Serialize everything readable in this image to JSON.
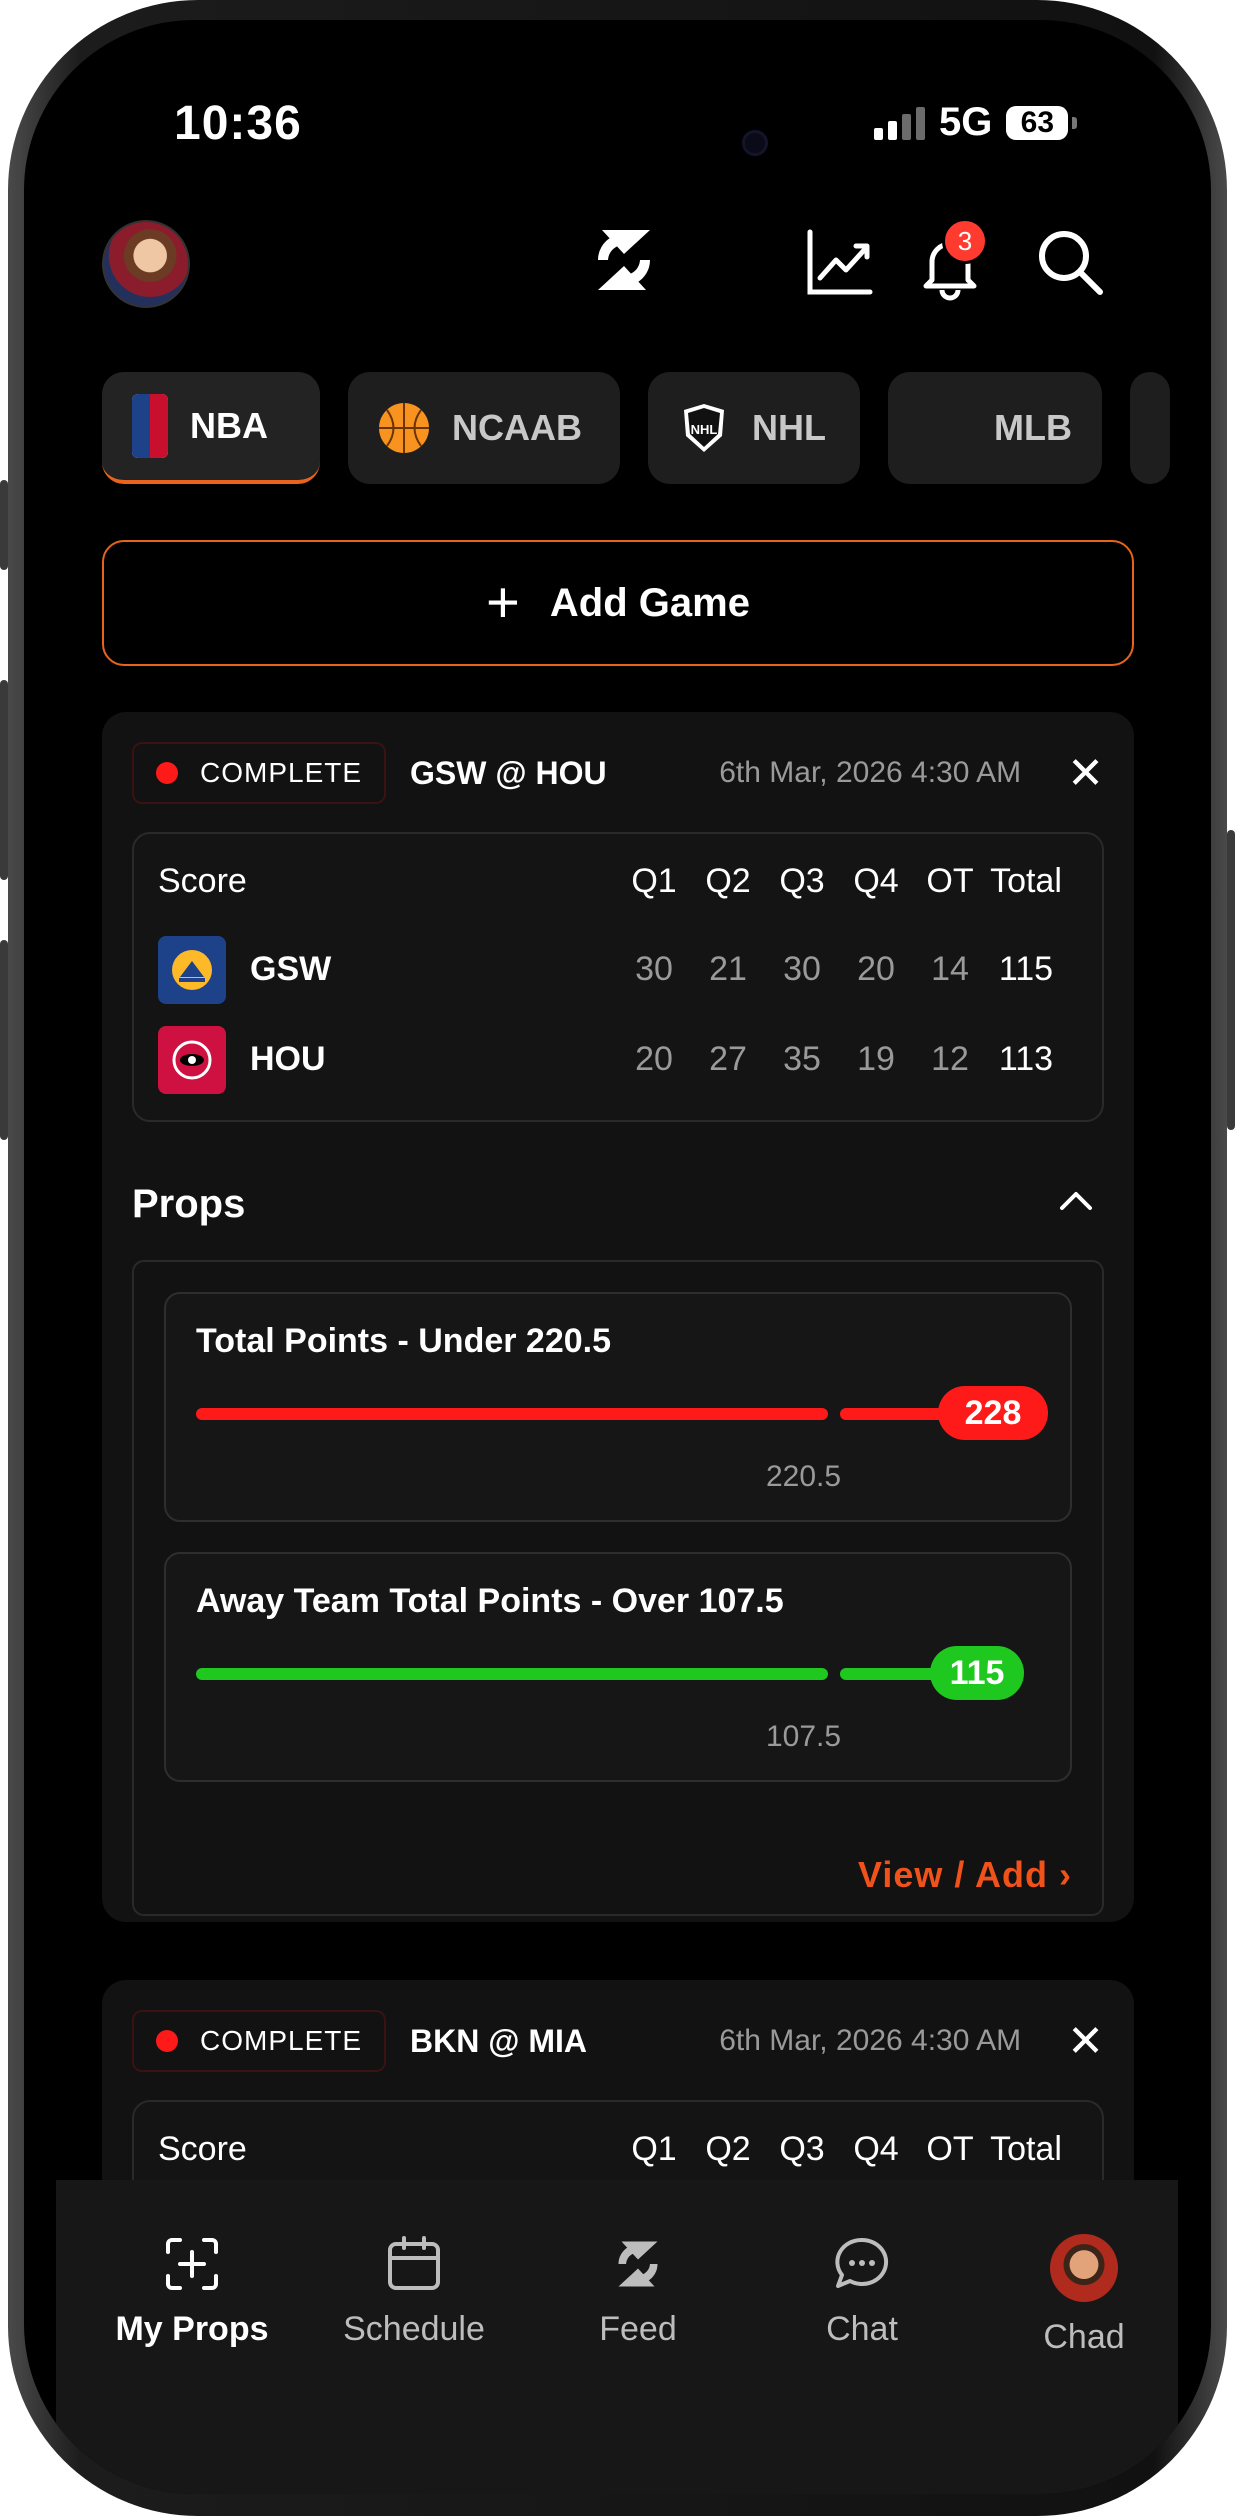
{
  "status_bar": {
    "time": "10:36",
    "network": "5G",
    "battery": "63"
  },
  "header": {
    "notification_count": "3",
    "icons": [
      "avatar",
      "brand-logo-icon",
      "chart-icon",
      "bell-icon",
      "search-icon"
    ]
  },
  "league_tabs": [
    {
      "label": "NBA",
      "icon": "nba-logo-icon",
      "active": true
    },
    {
      "label": "NCAAB",
      "icon": "basketball-icon",
      "active": false
    },
    {
      "label": "NHL",
      "icon": "nhl-logo-icon",
      "active": false
    },
    {
      "label": "MLB",
      "icon": "mlb-logo-icon",
      "active": false
    }
  ],
  "add_game_label": "Add Game",
  "games": [
    {
      "status": "COMPLETE",
      "matchup": "GSW @ HOU",
      "datetime": "6th Mar, 2026 4:30 AM",
      "score_header": {
        "label": "Score",
        "periods": [
          "Q1",
          "Q2",
          "Q3",
          "Q4",
          "OT",
          "Total"
        ]
      },
      "teams": [
        {
          "abbr": "GSW",
          "scores": [
            "30",
            "21",
            "30",
            "20",
            "14",
            "115"
          ],
          "color": "#1D428A"
        },
        {
          "abbr": "HOU",
          "scores": [
            "20",
            "27",
            "35",
            "19",
            "12",
            "113"
          ],
          "color": "#CE1141"
        }
      ],
      "props_title": "Props",
      "props": [
        {
          "title": "Total Points - Under 220.5",
          "line": "220.5",
          "actual": "228",
          "result_color": "#ff1a1a"
        },
        {
          "title": "Away Team Total Points - Over 107.5",
          "line": "107.5",
          "actual": "115",
          "result_color": "#1ec81e"
        }
      ],
      "view_add_label": "View / Add ›"
    },
    {
      "status": "COMPLETE",
      "matchup": "BKN @ MIA",
      "datetime": "6th Mar, 2026 4:30 AM",
      "score_header": {
        "label": "Score",
        "periods": [
          "Q1",
          "Q2",
          "Q3",
          "Q4",
          "OT",
          "Total"
        ]
      }
    }
  ],
  "tab_bar": [
    {
      "label": "My Props",
      "icon": "add-square-icon",
      "active": true
    },
    {
      "label": "Schedule",
      "icon": "calendar-icon",
      "active": false
    },
    {
      "label": "Feed",
      "icon": "brand-logo-icon",
      "active": false
    },
    {
      "label": "Chat",
      "icon": "chat-bubble-icon",
      "active": false
    },
    {
      "label": "Chad",
      "icon": "profile-avatar",
      "active": false
    }
  ],
  "colors": {
    "accent": "#e8631c",
    "link": "#f0521a",
    "loss": "#ff1a1a",
    "win": "#1ec81e",
    "live_dot": "#ff1a1a"
  }
}
